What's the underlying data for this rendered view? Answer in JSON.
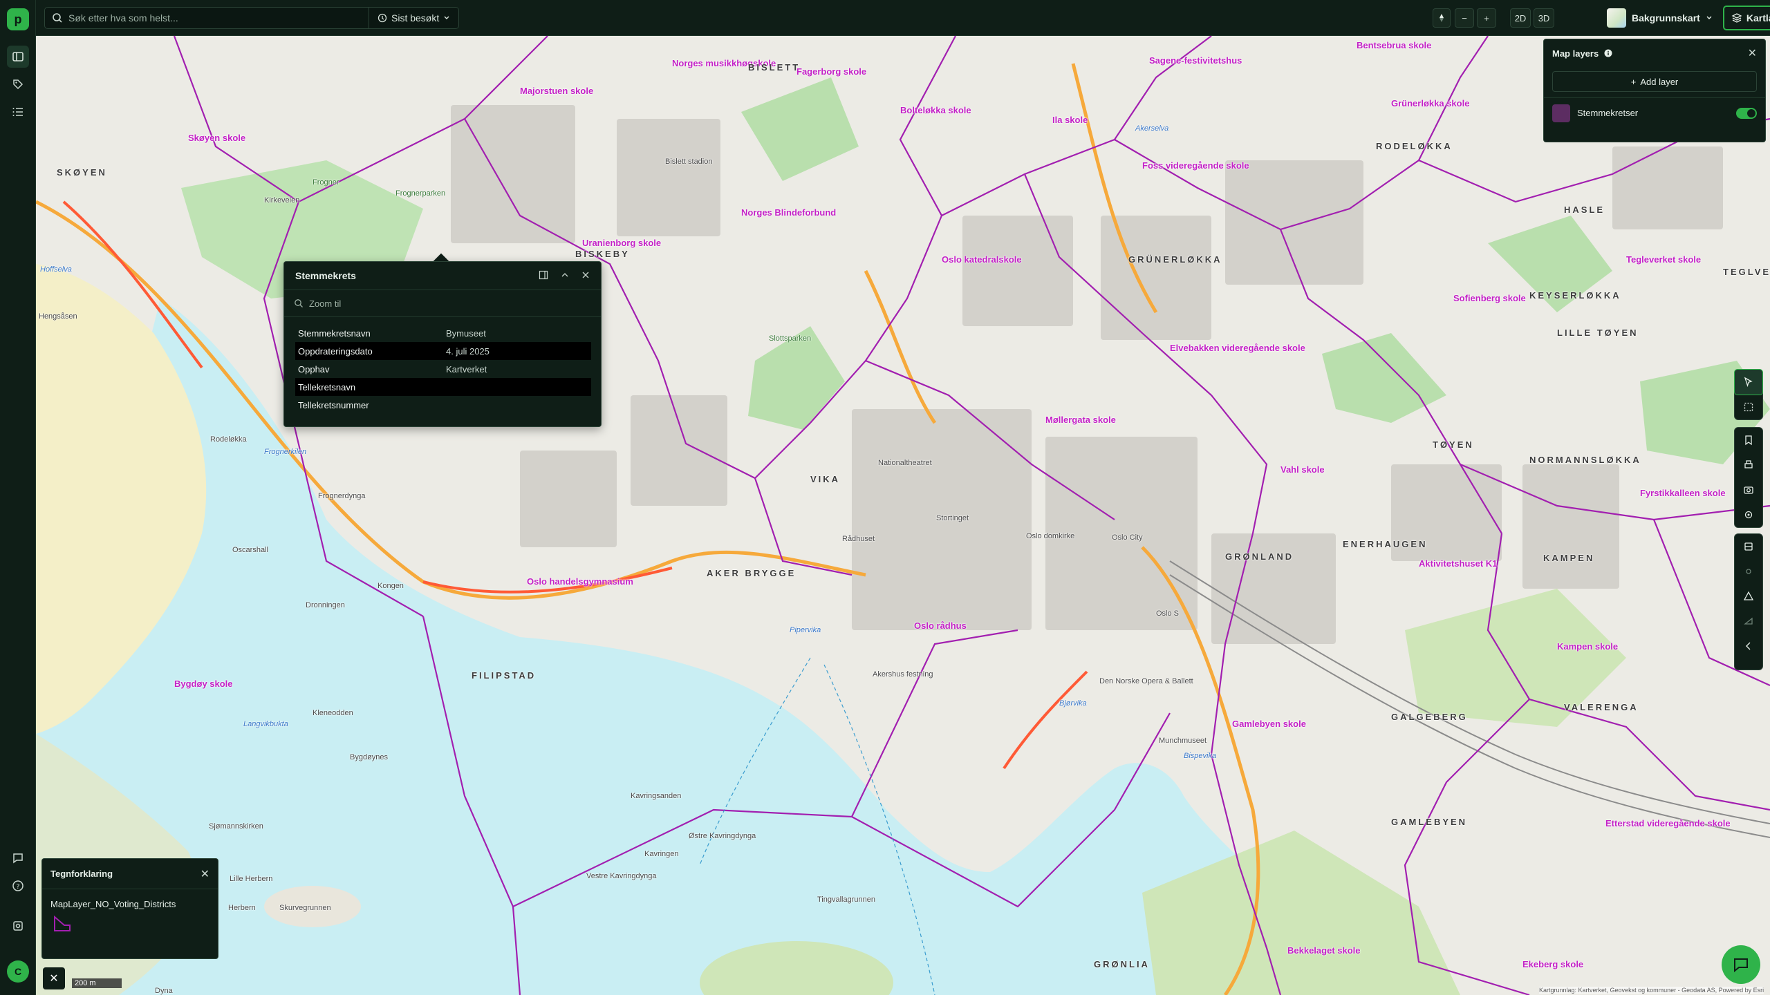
{
  "app": {
    "logo_letter": "p",
    "avatar_letter": "C"
  },
  "topbar": {
    "search_placeholder": "Søk etter hva som helst...",
    "recent_label": "Sist besøkt",
    "zoom_out": "−",
    "zoom_in": "+",
    "mode_2d": "2D",
    "mode_3d": "3D",
    "basemap_label": "Bakgrunnskart",
    "layers_label": "Kartlag"
  },
  "popup": {
    "title": "Stemmekrets",
    "zoom_placeholder": "Zoom til",
    "rows": [
      {
        "key": "Stemmekretsnavn",
        "value": "Bymuseet"
      },
      {
        "key": "Oppdrateringsdato",
        "value": "4. juli 2025"
      },
      {
        "key": "Opphav",
        "value": "Kartverket"
      },
      {
        "key": "Tellekretsnavn",
        "value": ""
      },
      {
        "key": "Tellekretsnummer",
        "value": ""
      }
    ]
  },
  "layers_panel": {
    "title": "Map layers",
    "add_label": "Add layer",
    "layer_name": "Stemmekretser",
    "layer_color": "#5c2d62"
  },
  "legend": {
    "title": "Tegnforklaring",
    "layer_name": "MapLayer_NO_Voting_Districts"
  },
  "map": {
    "scale_label": "200 m",
    "attribution": "Kartgrunnlag: Kartverket, Geovekst og kommuner - Geodata AS, Powered by Esri",
    "district_color": "#a21fb0",
    "labels": {
      "schools": [
        "Majorstuen skole",
        "Norges musikkhøgskole",
        "Fagerborg skole",
        "Bolteløkka skole",
        "Ila skole",
        "Sagene-festivitetshus",
        "Bentsebrua skole",
        "Grünerløkka skole",
        "Skøyen skole",
        "Uranienborg skole",
        "Norges Blindeforbund",
        "Oslo katedralskole",
        "Foss videregående skole",
        "Sofienberg skole",
        "Elvebakken videregående skole",
        "Møllergata skole",
        "Vahl skole",
        "Oslo handelsgymnasium",
        "Oslo rådhus",
        "Gamlebyen skole",
        "Bygdøy skole",
        "Kampen skole",
        "Etterstad videregående skole",
        "Bekkelaget skole",
        "Ekeberg skole",
        "Tegleverket skole",
        "Aktivitetshuset K1",
        "Fyrstikkalleen skole"
      ],
      "areas": [
        "SKØYEN",
        "BISLETT",
        "BISKEBY",
        "GRÜNERLØKKA",
        "RODELØKKA",
        "HASLE",
        "KEYSERLØKKA",
        "LILLE TØYEN",
        "TØYEN",
        "NORMANNSLØKKA",
        "GRØNLAND",
        "ENERHAUGEN",
        "KAMPEN",
        "VIKA",
        "AKER BRYGGE",
        "FILIPSTAD",
        "GALGEBERG",
        "VALERENGA",
        "GAMLEBYEN",
        "GRØNLIA",
        "TEGLVE"
      ],
      "water": [
        "Frognerkilen",
        "Pipervika",
        "Bjørvika",
        "Akerselva",
        "Langvikbukta",
        "Bispevika",
        "Hoffselva"
      ],
      "places": [
        "Frognerparken",
        "Frogner",
        "Slottsparken",
        "Akershus festning",
        "Kavringsanden",
        "Østre Kavringdynga",
        "Vestre Kavringdynga",
        "Kavringen",
        "Tingvallagrunnen",
        "Kongen",
        "Dronningen",
        "Bygdøynes",
        "Kleneodden",
        "Lille Herbern",
        "Herbern",
        "Skurvegrunnen",
        "Frognerdynga",
        "Nationaltheatret",
        "Stortinget",
        "Rådhuset",
        "Oslo domkirke",
        "Oslo S",
        "Oslo City",
        "Den Norske Opera & Ballett",
        "Munchmuseet",
        "Sjømannskirken",
        "Dyna",
        "Oscarshall",
        "Rodeløkka",
        "Hengsåsen",
        "Kirkeveien",
        "Bislett stadion"
      ]
    }
  }
}
